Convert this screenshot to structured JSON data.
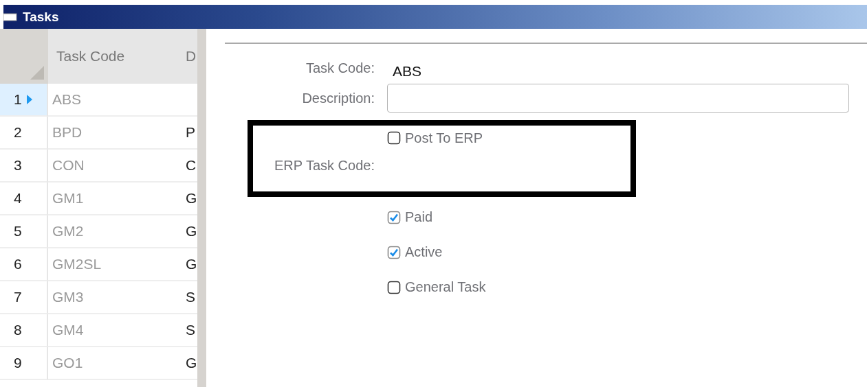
{
  "window": {
    "title": "Tasks"
  },
  "grid": {
    "columns": [
      "Task Code",
      "D"
    ],
    "rows": [
      {
        "number": "1",
        "code": "ABS",
        "column_3": "",
        "selected": true
      },
      {
        "number": "2",
        "code": "BPD",
        "column_3": "P",
        "selected": false
      },
      {
        "number": "3",
        "code": "CON",
        "column_3": "C",
        "selected": false
      },
      {
        "number": "4",
        "code": "GM1",
        "column_3": "G",
        "selected": false
      },
      {
        "number": "5",
        "code": "GM2",
        "column_3": "G",
        "selected": false
      },
      {
        "number": "6",
        "code": "GM2SL",
        "column_3": "G",
        "selected": false
      },
      {
        "number": "7",
        "code": "GM3",
        "column_3": "S",
        "selected": false
      },
      {
        "number": "8",
        "code": "GM4",
        "column_3": "S",
        "selected": false
      },
      {
        "number": "9",
        "code": "GO1",
        "column_3": "G",
        "selected": false
      }
    ]
  },
  "form": {
    "task_code": {
      "label": "Task Code:",
      "value": "ABS"
    },
    "description": {
      "label": "Description:"
    },
    "post_to_erp": {
      "label": "Post To ERP",
      "checked": false
    },
    "erp_task_code": {
      "label": "ERP Task Code:"
    },
    "checkboxes": [
      {
        "label": "Paid",
        "checked": true
      },
      {
        "label": "Active",
        "checked": true
      },
      {
        "label": "General Task",
        "checked": false
      }
    ]
  }
}
